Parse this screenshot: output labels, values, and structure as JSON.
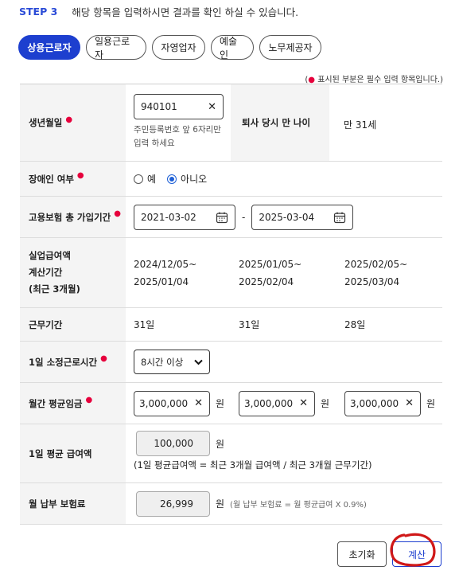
{
  "step": {
    "label": "STEP 3",
    "description": "해당 항목을 입력하시면 결과를 확인 하실 수 있습니다."
  },
  "tabs": [
    {
      "label": "상용근로자",
      "active": true
    },
    {
      "label": "일용근로자",
      "active": false
    },
    {
      "label": "자영업자",
      "active": false
    },
    {
      "label": "예술인",
      "active": false
    },
    {
      "label": "노무제공자",
      "active": false
    }
  ],
  "required_note": {
    "open": "(",
    "dot": "●",
    "text": " 표시된 부분은 필수 입력 항목입니다.)"
  },
  "form": {
    "birth": {
      "label": "생년월일",
      "value": "940101",
      "helper_line1": "주민등록번호 앞 6자리만",
      "helper_line2": "입력 하세요",
      "age_label": "퇴사 당시 만 나이",
      "age_value": "만 31세"
    },
    "disability": {
      "label": "장애인 여부",
      "option_yes": "예",
      "option_no": "아니오",
      "selected": "아니오"
    },
    "insurance_period": {
      "label": "고용보험 총 가입기간",
      "start": "2021-03-02",
      "separator": "-",
      "end": "2025-03-04"
    },
    "calc_period": {
      "label_line1": "실업급여액",
      "label_line2": "계산기간",
      "label_line3": "(최근 3개월)",
      "periods": [
        {
          "from": "2024/12/05~",
          "to": "2025/01/04"
        },
        {
          "from": "2025/01/05~",
          "to": "2025/02/04"
        },
        {
          "from": "2025/02/05~",
          "to": "2025/03/04"
        }
      ]
    },
    "work_days": {
      "label": "근무기간",
      "values": [
        "31일",
        "31일",
        "28일"
      ]
    },
    "daily_hours": {
      "label": "1일 소정근로시간",
      "selected": "8시간 이상"
    },
    "monthly_wage": {
      "label": "월간 평균임금",
      "values": [
        "3,000,000",
        "3,000,000",
        "3,000,000"
      ],
      "unit": "원"
    },
    "daily_avg": {
      "label": "1일 평균 급여액",
      "value": "100,000",
      "unit": "원",
      "formula": "(1일 평균급여액 = 최근 3개월 급여액 / 최근 3개월 근무기간)"
    },
    "premium": {
      "label": "월 납부 보험료",
      "value": "26,999",
      "unit": "원",
      "note": "(월 납부 보험료 = 월 평균급여 X 0.9%)"
    }
  },
  "buttons": {
    "reset": "초기화",
    "calculate": "계산"
  },
  "colors": {
    "accent": "#1d3fcf",
    "required": "#e6003c",
    "annotation": "#d01818"
  }
}
